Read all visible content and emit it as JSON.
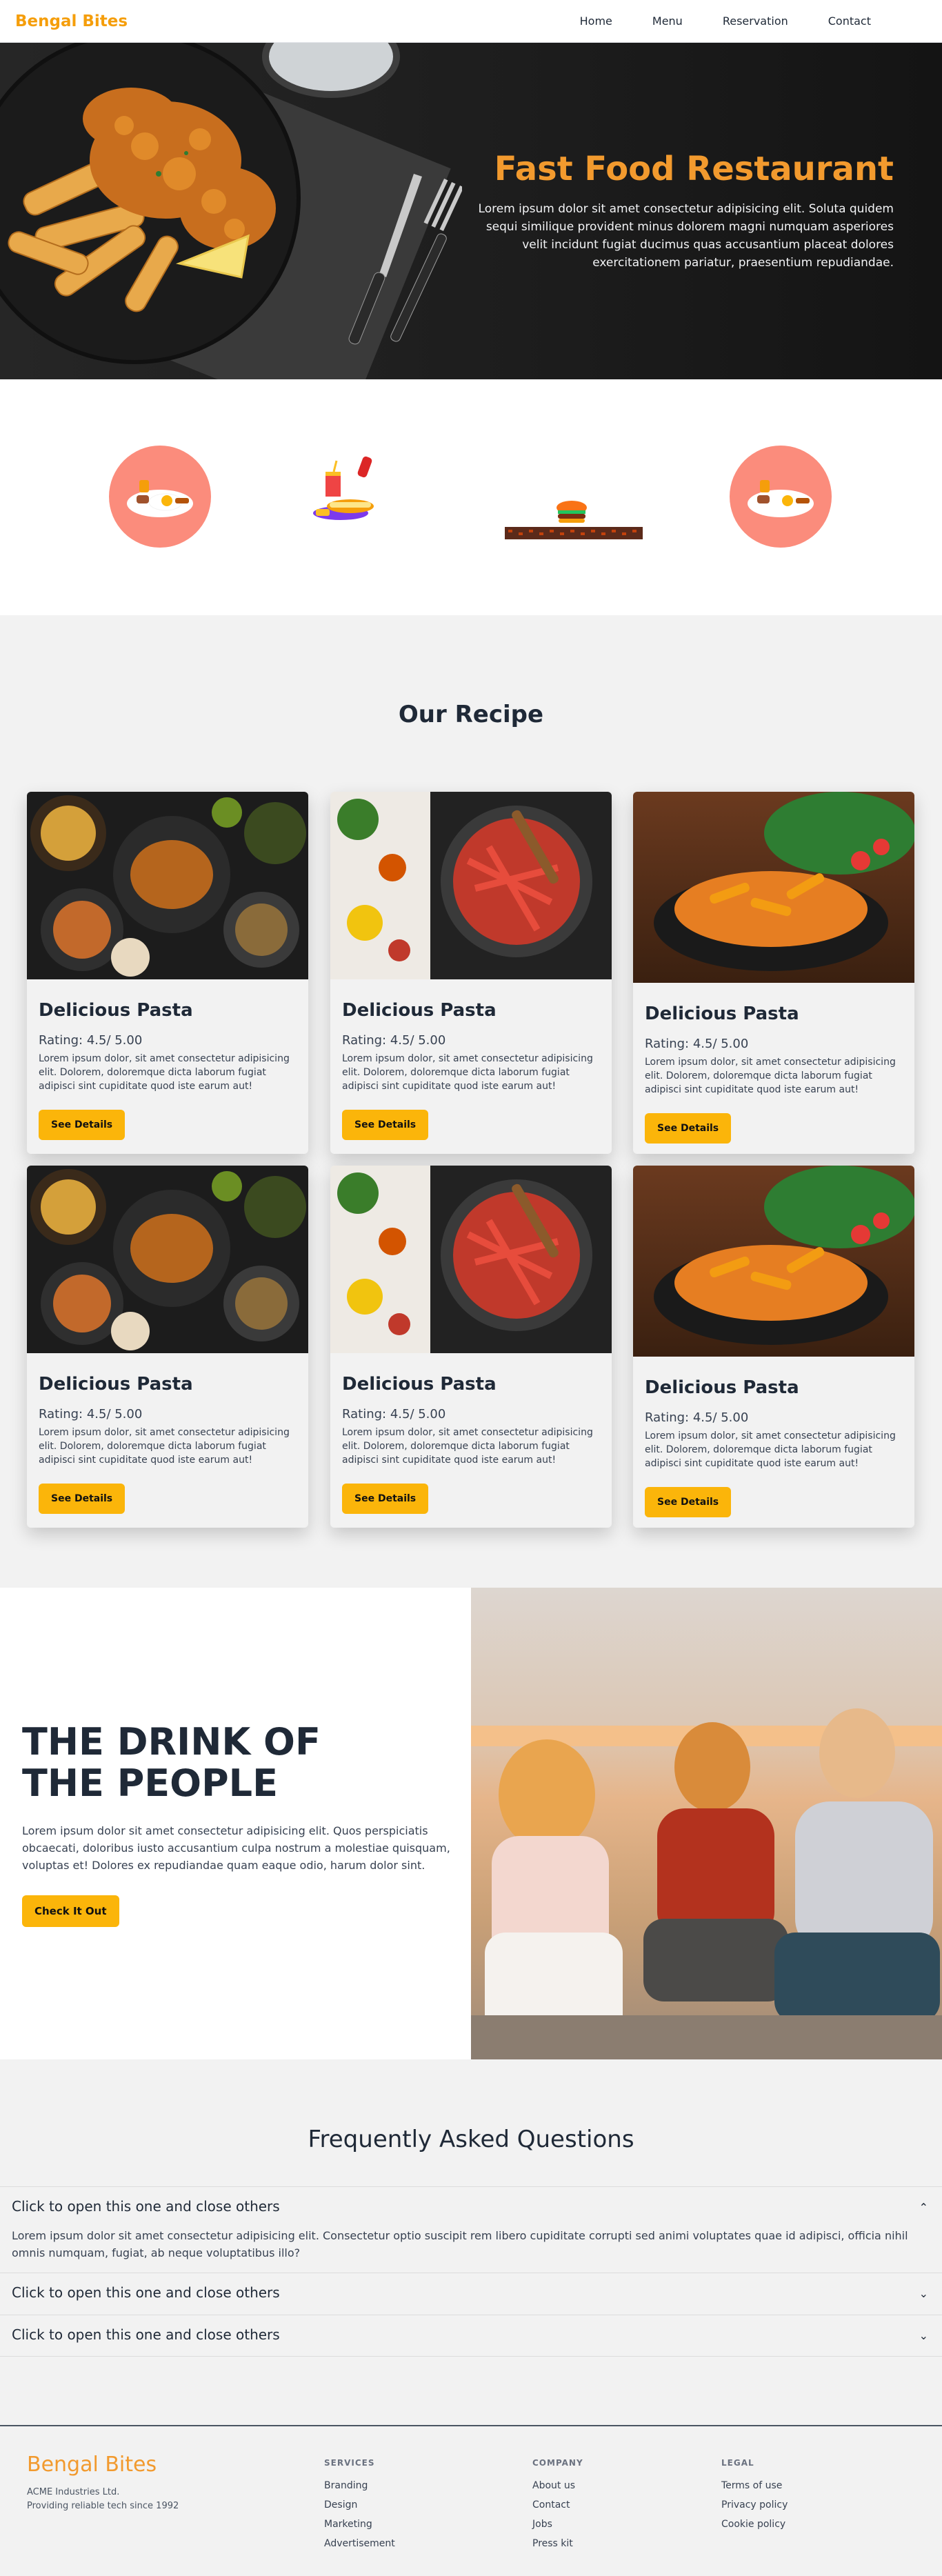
{
  "nav": {
    "logo": "Bengal Bites",
    "links": [
      "Home",
      "Menu",
      "Reservation",
      "Contact"
    ]
  },
  "hero": {
    "title": "Fast Food Restaurant",
    "text": "Lorem ipsum dolor sit amet consectetur adipisicing elit. Soluta quidem sequi similique provident minus dolorem magni numquam asperiores velit incidunt fugiat ducimus quas accusantium placeat dolores exercitationem pariatur, praesentium repudiandae."
  },
  "icons": [
    "breakfast-icon",
    "burger-combo-icon",
    "burger-icon",
    "breakfast-icon"
  ],
  "recipes": {
    "title": "Our Recipe",
    "cards": [
      {
        "title": "Delicious Pasta",
        "rating": "Rating: 4.5/ 5.00",
        "desc": "Lorem ipsum dolor, sit amet consectetur adipisicing elit. Dolorem, doloremque dicta laborum fugiat adipisci sint cupiditate quod iste earum aut!",
        "button": "See Details"
      },
      {
        "title": "Delicious Pasta",
        "rating": "Rating: 4.5/ 5.00",
        "desc": "Lorem ipsum dolor, sit amet consectetur adipisicing elit. Dolorem, doloremque dicta laborum fugiat adipisci sint cupiditate quod iste earum aut!",
        "button": "See Details"
      },
      {
        "title": "Delicious Pasta",
        "rating": "Rating: 4.5/ 5.00",
        "desc": "Lorem ipsum dolor, sit amet consectetur adipisicing elit. Dolorem, doloremque dicta laborum fugiat adipisci sint cupiditate quod iste earum aut!",
        "button": "See Details"
      },
      {
        "title": "Delicious Pasta",
        "rating": "Rating: 4.5/ 5.00",
        "desc": "Lorem ipsum dolor, sit amet consectetur adipisicing elit. Dolorem, doloremque dicta laborum fugiat adipisci sint cupiditate quod iste earum aut!",
        "button": "See Details"
      },
      {
        "title": "Delicious Pasta",
        "rating": "Rating: 4.5/ 5.00",
        "desc": "Lorem ipsum dolor, sit amet consectetur adipisicing elit. Dolorem, doloremque dicta laborum fugiat adipisci sint cupiditate quod iste earum aut!",
        "button": "See Details"
      },
      {
        "title": "Delicious Pasta",
        "rating": "Rating: 4.5/ 5.00",
        "desc": "Lorem ipsum dolor, sit amet consectetur adipisicing elit. Dolorem, doloremque dicta laborum fugiat adipisci sint cupiditate quod iste earum aut!",
        "button": "See Details"
      }
    ]
  },
  "drink": {
    "title": "THE DRINK OF THE PEOPLE",
    "text": "Lorem ipsum dolor sit amet consectetur adipisicing elit. Quos perspiciatis obcaecati, doloribus iusto accusantium culpa nostrum a molestiae quisquam, voluptas et! Dolores ex repudiandae quam eaque odio, harum dolor sint.",
    "button": "Check It Out"
  },
  "faq": {
    "title": "Frequently Asked Questions",
    "items": [
      {
        "question": "Click to open this one and close others",
        "answer": "Lorem ipsum dolor sit amet consectetur adipisicing elit. Consectetur optio suscipit rem libero cupiditate corrupti sed animi voluptates quae id adipisci, officia nihil omnis numquam, fugiat, ab neque voluptatibus illo?",
        "open": true
      },
      {
        "question": "Click to open this one and close others",
        "open": false
      },
      {
        "question": "Click to open this one and close others",
        "open": false
      }
    ]
  },
  "footer": {
    "logo": "Bengal Bites",
    "company_name": "ACME Industries Ltd.",
    "tagline": "Providing reliable tech since 1992",
    "columns": [
      {
        "heading": "SERVICES",
        "links": [
          "Branding",
          "Design",
          "Marketing",
          "Advertisement"
        ]
      },
      {
        "heading": "COMPANY",
        "links": [
          "About us",
          "Contact",
          "Jobs",
          "Press kit"
        ]
      },
      {
        "heading": "LEGAL",
        "links": [
          "Terms of use",
          "Privacy policy",
          "Cookie policy"
        ]
      }
    ]
  },
  "colors": {
    "accent": "#f29a2e",
    "button": "#fbb50a",
    "text": "#1f2937"
  }
}
